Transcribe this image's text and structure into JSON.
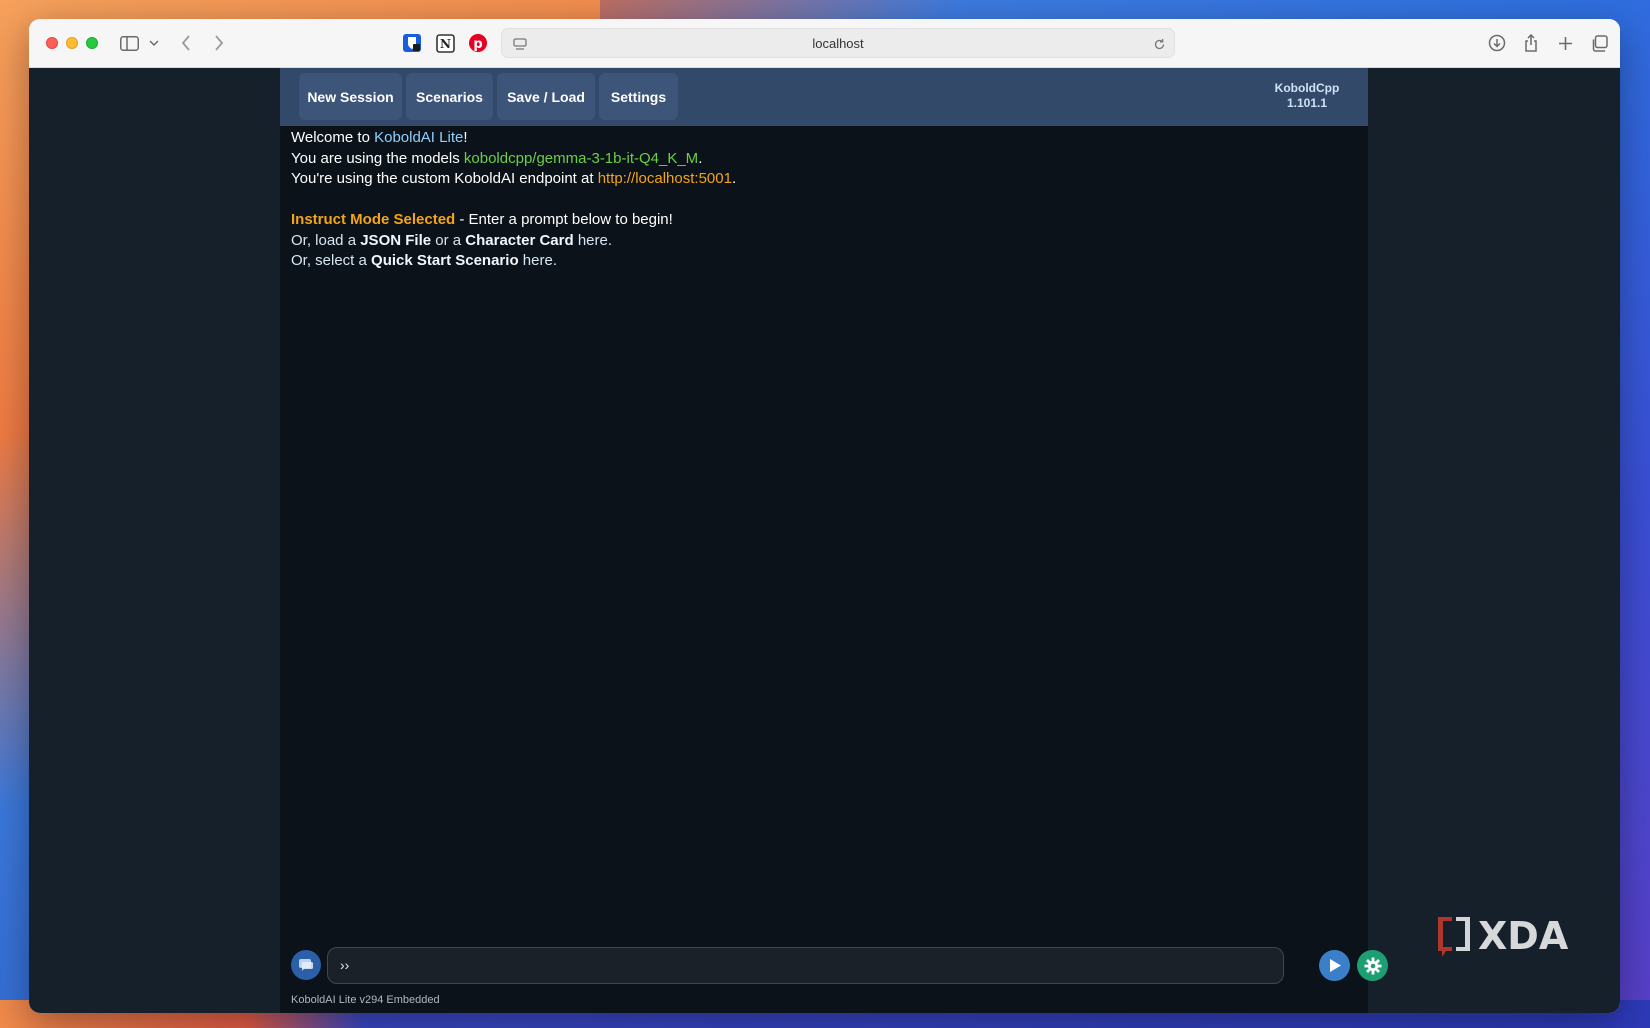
{
  "browser": {
    "address": "localhost"
  },
  "app": {
    "nav": [
      "New Session",
      "Scenarios",
      "Save / Load",
      "Settings"
    ],
    "brand_name": "KoboldCpp",
    "brand_version": "1.101.1"
  },
  "welcome": {
    "line1_prefix": "Welcome to ",
    "line1_link": "KoboldAI Lite",
    "line1_suffix": "!",
    "line2_prefix": "You are using the models ",
    "line2_model": "koboldcpp/gemma-3-1b-it-Q4_K_M",
    "line2_suffix": ".",
    "line3_prefix": "You're using the custom KoboldAI endpoint at ",
    "line3_endpoint": "http://localhost:5001",
    "line3_suffix": ".",
    "line4_mode": "Instruct Mode Selected",
    "line4_rest": " - Enter a prompt below to begin!",
    "line5_a": "Or, load a ",
    "line5_json": "JSON File",
    "line5_b": " or a ",
    "line5_card": "Character Card",
    "line5_here": " here",
    "line5_c": ".",
    "line6_a": "Or, select a ",
    "line6_scenario": "Quick Start Scenario",
    "line6_here": " here",
    "line6_c": "."
  },
  "input": {
    "value": "››"
  },
  "footer": {
    "version": "KoboldAI Lite v294 Embedded"
  },
  "watermark": "XDA",
  "colors": {
    "link_blue": "#8ed0ff",
    "model_green": "#6ccf45",
    "accent_orange": "#f3a417",
    "menu_bar": "#33496a"
  }
}
